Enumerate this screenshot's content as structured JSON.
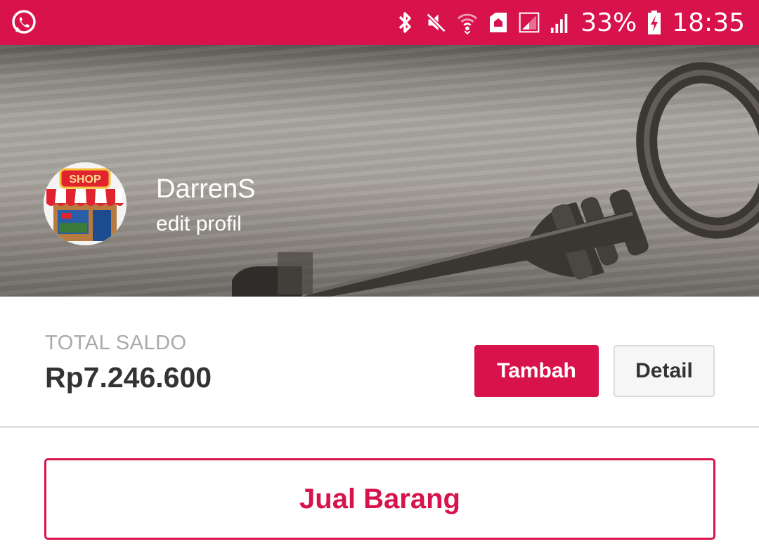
{
  "status_bar": {
    "battery_percent": "33%",
    "time": "18:35",
    "icons": [
      "whatsapp-icon",
      "bluetooth-icon",
      "mute-icon",
      "wifi-icon",
      "home-icon",
      "signal-sim1-icon",
      "signal-icon",
      "battery-charging-icon"
    ],
    "background_color": "#d8124b"
  },
  "profile": {
    "name": "DarrenS",
    "edit_link": "edit profil",
    "avatar_icon": "shop-storefront-icon"
  },
  "saldo": {
    "label": "TOTAL SALDO",
    "value": "Rp7.246.600",
    "tambah_label": "Tambah",
    "detail_label": "Detail"
  },
  "actions": {
    "jual_label": "Jual Barang"
  },
  "colors": {
    "accent": "#d8124b",
    "text_dark": "#333333",
    "text_muted": "#a9a9a9"
  }
}
